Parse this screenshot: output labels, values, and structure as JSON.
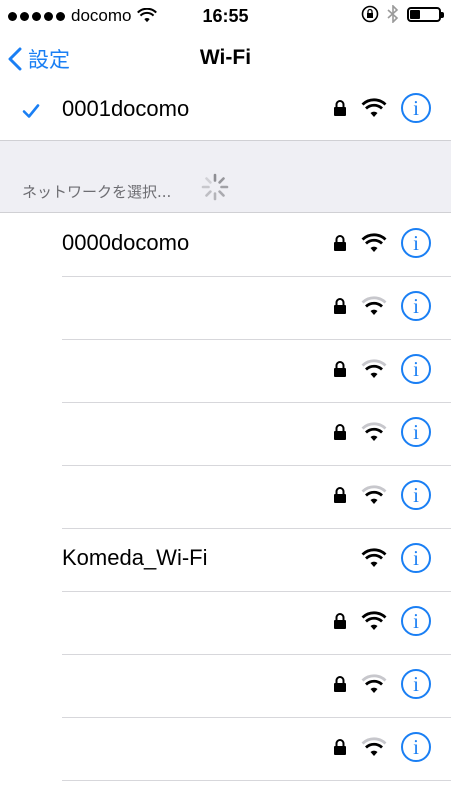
{
  "status_bar": {
    "carrier": "docomo",
    "time": "16:55",
    "battery_level": 0.35
  },
  "nav": {
    "back_label": "設定",
    "title": "Wi-Fi"
  },
  "connected_network": {
    "name": "0001docomo",
    "locked": true,
    "signal": "strong"
  },
  "section": {
    "label": "ネットワークを選択..."
  },
  "networks": [
    {
      "name": "0000docomo",
      "locked": true,
      "signal": "strong"
    },
    {
      "name": "",
      "locked": true,
      "signal": "medium"
    },
    {
      "name": "",
      "locked": true,
      "signal": "medium"
    },
    {
      "name": "",
      "locked": true,
      "signal": "medium"
    },
    {
      "name": "",
      "locked": true,
      "signal": "medium"
    },
    {
      "name": "Komeda_Wi-Fi",
      "locked": false,
      "signal": "strong"
    },
    {
      "name": "",
      "locked": true,
      "signal": "strong"
    },
    {
      "name": "",
      "locked": true,
      "signal": "medium"
    },
    {
      "name": "",
      "locked": true,
      "signal": "medium"
    }
  ],
  "colors": {
    "accent": "#1a7ff4",
    "section_bg": "#efeff4",
    "section_text": "#6d6d72"
  },
  "icons": {
    "checkmark": "checkmark-icon",
    "lock": "lock-icon",
    "wifi": "wifi-icon",
    "info": "info-icon",
    "back": "chevron-left-icon"
  }
}
